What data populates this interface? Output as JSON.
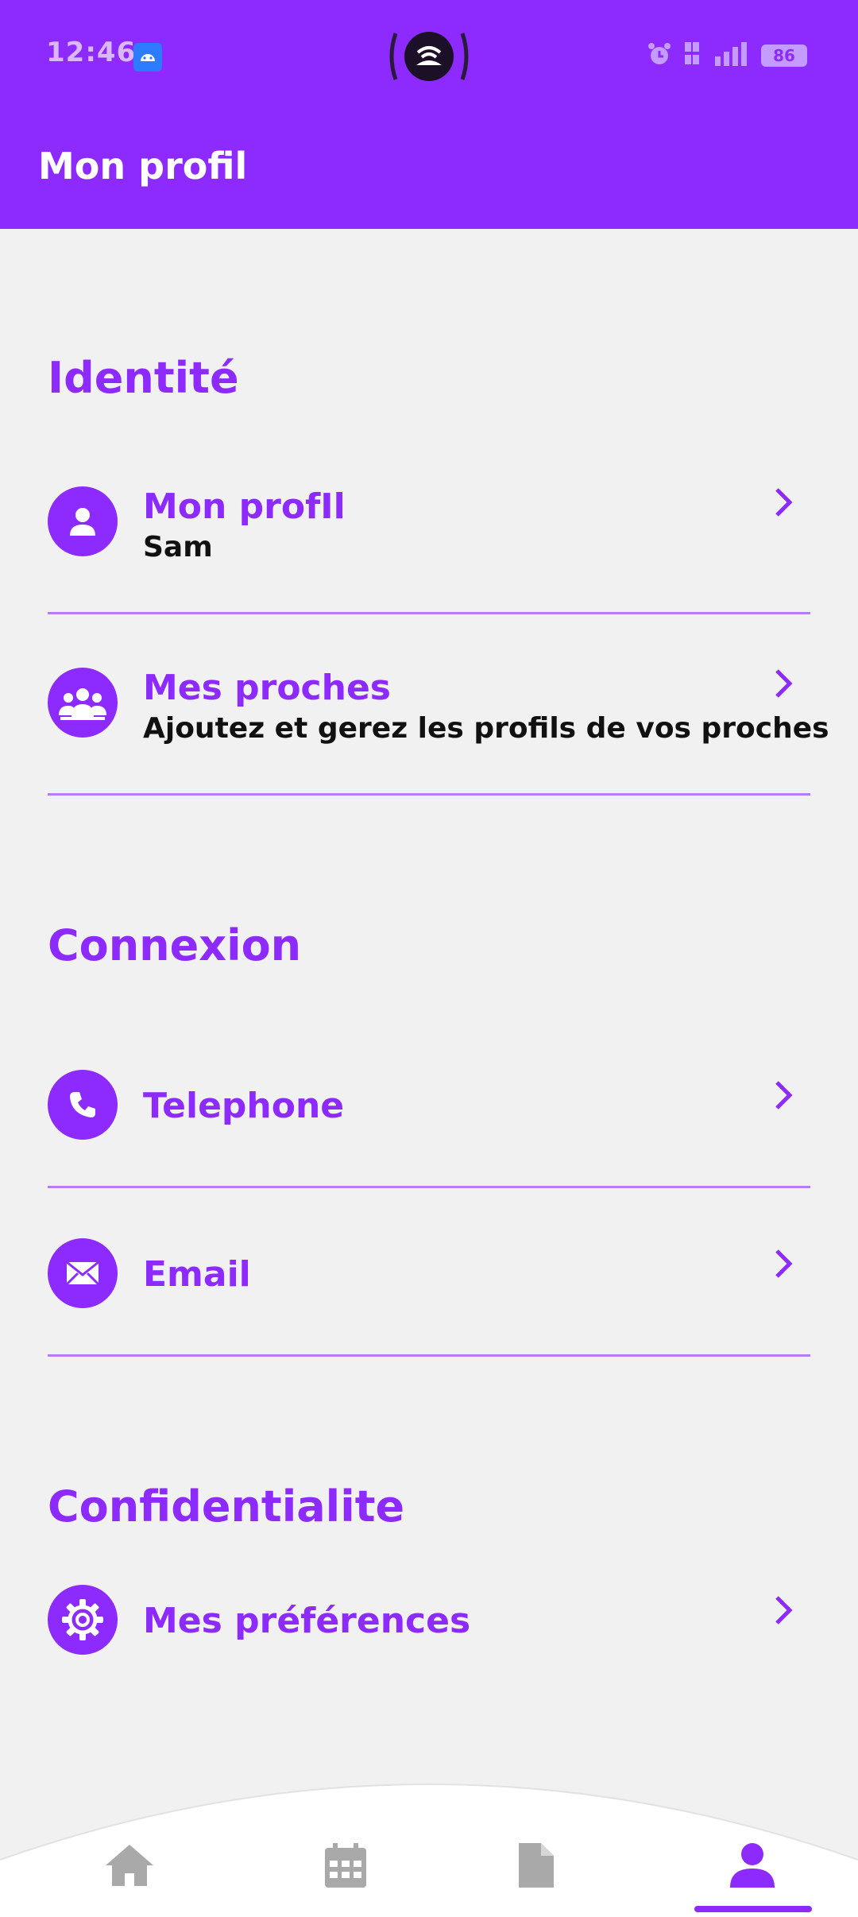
{
  "status_bar": {
    "time": "12:46",
    "battery": "86",
    "icons": [
      "android-notification-icon",
      "hotspot-icon",
      "alarm-icon",
      "volte-icon",
      "5g-signal-icon",
      "battery-icon"
    ]
  },
  "app_bar": {
    "title": "Mon profil"
  },
  "sections": {
    "identity": {
      "title": "Identité",
      "items": [
        {
          "title": "Mon profIl",
          "subtitle": "Sam",
          "icon": "person-icon"
        },
        {
          "title": "Mes proches",
          "subtitle": "Ajoutez et gerez les profils de vos proches",
          "icon": "group-icon"
        }
      ]
    },
    "connexion": {
      "title": "Connexion",
      "items": [
        {
          "title": "Telephone",
          "icon": "phone-icon"
        },
        {
          "title": "Email",
          "icon": "mail-icon"
        }
      ]
    },
    "confidentialite": {
      "title": "Confidentialite",
      "items": [
        {
          "title": "Mes préférences",
          "icon": "gear-icon"
        }
      ]
    }
  },
  "bottom_nav": {
    "items": [
      "home-icon",
      "calendar-icon",
      "document-icon",
      "profile-icon"
    ],
    "active": "profile-icon"
  },
  "colors": {
    "primary": "#8d2bff",
    "background": "#f1f1f1",
    "divider": "#b47df5",
    "inactive_nav": "#a9a9a9"
  }
}
